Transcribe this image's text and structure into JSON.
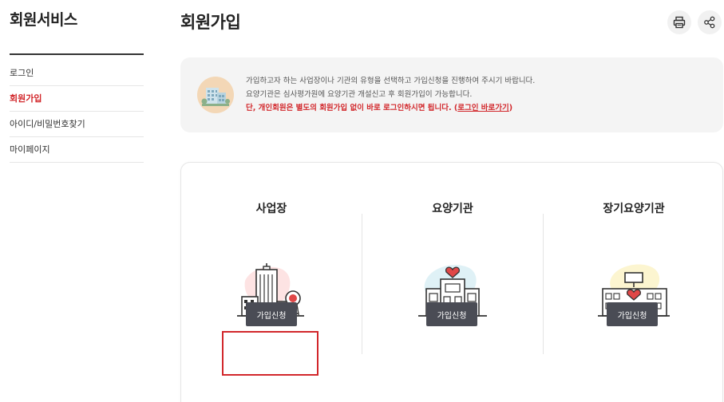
{
  "sidebar": {
    "title": "회원서비스",
    "items": [
      {
        "label": "로그인"
      },
      {
        "label": "회원가입"
      },
      {
        "label": "아이디/비밀번호찾기"
      },
      {
        "label": "마이페이지"
      }
    ],
    "active_index": 1
  },
  "header": {
    "title": "회원가입",
    "print_icon": "printer-icon",
    "share_icon": "share-icon"
  },
  "notice": {
    "icon": "building-icon",
    "line1": "가입하고자 하는 사업장이나 기관의 유형을 선택하고 가입신청을 진행하여 주시기 바랍니다.",
    "line2": "요양기관은 심사평가원에 요양기관 개설신고 후 회원가입이 가능합니다.",
    "line3_prefix": "단, 개인회원은 별도의 회원가입 없이 바로 로그인하시면 됩니다. (",
    "line3_link": "로그인 바로가기",
    "line3_suffix": ")"
  },
  "cards": [
    {
      "title": "사업장",
      "button": "가입신청",
      "icon": "office-building-icon",
      "blob_color": "#fde3e3"
    },
    {
      "title": "요양기관",
      "button": "가입신청",
      "icon": "care-facility-icon",
      "blob_color": "#dff1f6"
    },
    {
      "title": "장기요양기관",
      "button": "가입신청",
      "icon": "long-term-care-facility-icon",
      "blob_color": "#fcf5d0"
    }
  ],
  "colors": {
    "accent_red": "#d2272b",
    "button_dark": "#4a4c55",
    "notice_bg": "#f4f4f4"
  }
}
